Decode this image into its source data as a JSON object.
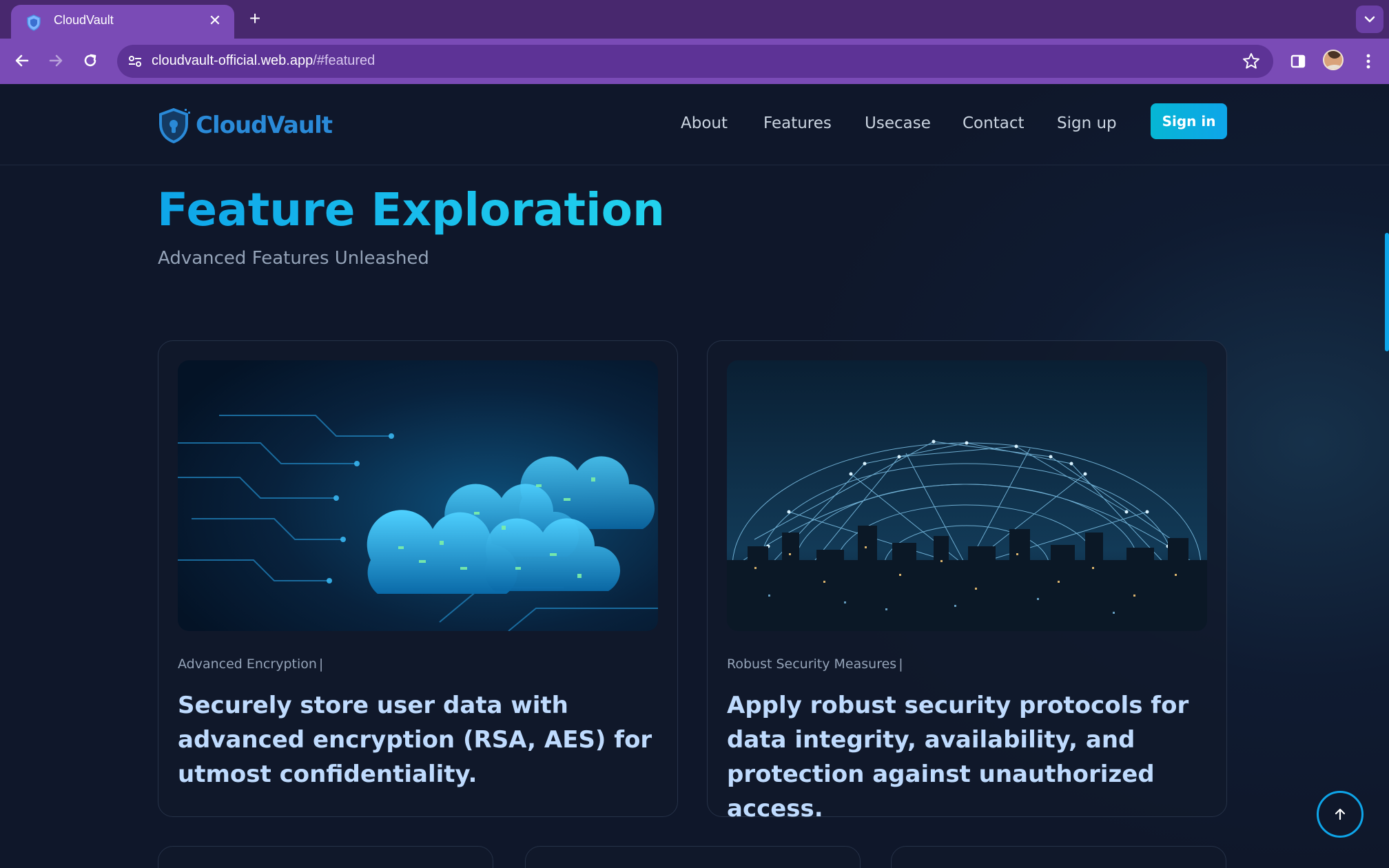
{
  "browser": {
    "tab": {
      "title": "CloudVault",
      "favicon": "shield-icon"
    },
    "address": {
      "host": "cloudvault-official.web.app",
      "path": "/#featured"
    },
    "colors": {
      "tabbar": "#48286e",
      "toolbar": "#7a4bb6",
      "omnibox": "#5d3396"
    }
  },
  "site": {
    "logo": {
      "text": "CloudVault",
      "icon": "shield-lock-icon"
    },
    "nav": [
      "About",
      "Features",
      "Usecase",
      "Contact",
      "Sign up"
    ],
    "signin_label": "Sign in",
    "colors": {
      "background": "#0f172a",
      "accent": "#0ea5e9",
      "accent_light": "#22d3ee",
      "card_text": "#bfdbfe"
    }
  },
  "hero": {
    "title": "Feature Exploration",
    "subtitle": "Advanced Features Unleashed"
  },
  "cards": [
    {
      "image": "encrypted-cloud-circuit-image",
      "tag": "Advanced Encryption",
      "text": "Securely store user data with advanced encryption (RSA, AES) for utmost confidentiality."
    },
    {
      "image": "network-dome-city-image",
      "tag": "Robust Security Measures",
      "text": "Apply robust security protocols for data integrity, availability, and protection against unauthorized access."
    }
  ],
  "scroll_top": {
    "icon": "arrow-up-icon"
  }
}
